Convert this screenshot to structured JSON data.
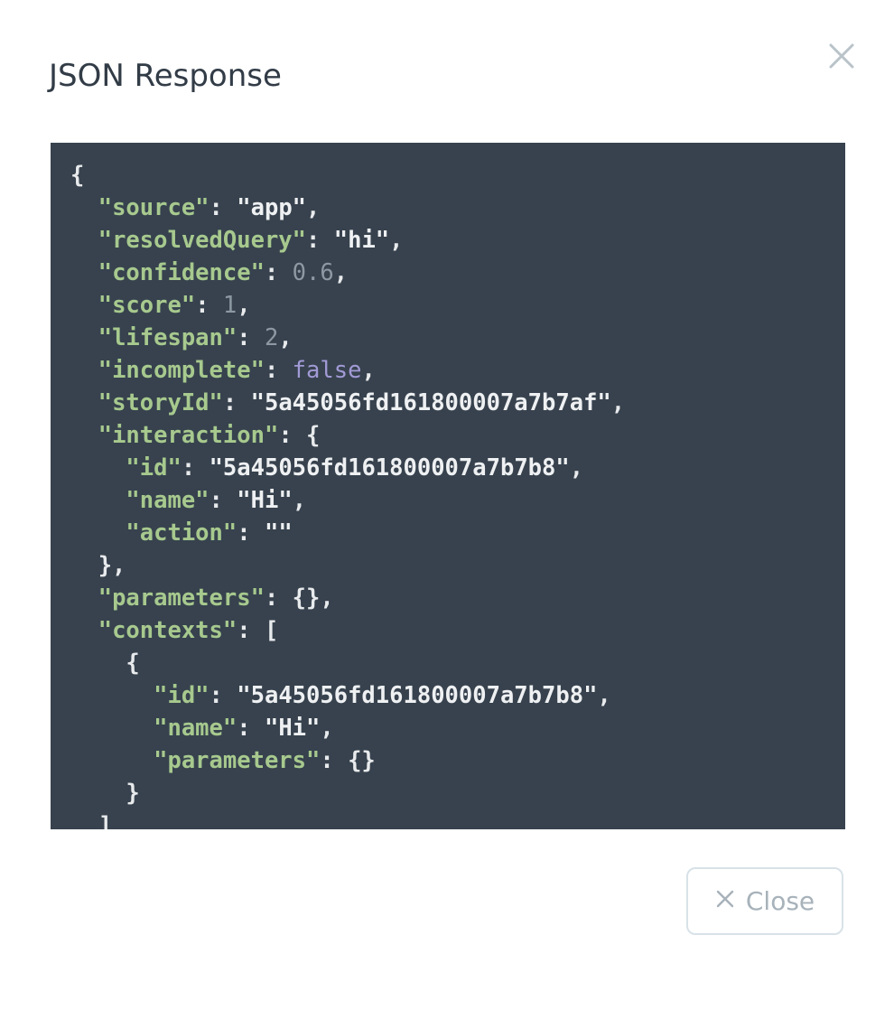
{
  "modal": {
    "title": "JSON Response",
    "close_icon": "close-icon",
    "footer_close_label": "Close",
    "colors": {
      "panel_bg": "#37424e",
      "key": "#a7c98e",
      "string": "#eef0f2",
      "number": "#8d98a3",
      "boolean": "#a29ad6",
      "title": "#323c47",
      "button_border": "#d8e2e8",
      "button_text": "#a7b2ba"
    }
  },
  "code_lines": [
    [
      {
        "t": "p",
        "v": "{"
      }
    ],
    [
      {
        "t": "p",
        "v": "  "
      },
      {
        "t": "k",
        "v": "\"source\""
      },
      {
        "t": "p",
        "v": ": "
      },
      {
        "t": "s",
        "v": "\"app\""
      },
      {
        "t": "p",
        "v": ","
      }
    ],
    [
      {
        "t": "p",
        "v": "  "
      },
      {
        "t": "k",
        "v": "\"resolvedQuery\""
      },
      {
        "t": "p",
        "v": ": "
      },
      {
        "t": "s",
        "v": "\"hi\""
      },
      {
        "t": "p",
        "v": ","
      }
    ],
    [
      {
        "t": "p",
        "v": "  "
      },
      {
        "t": "k",
        "v": "\"confidence\""
      },
      {
        "t": "p",
        "v": ": "
      },
      {
        "t": "n",
        "v": "0.6"
      },
      {
        "t": "p",
        "v": ","
      }
    ],
    [
      {
        "t": "p",
        "v": "  "
      },
      {
        "t": "k",
        "v": "\"score\""
      },
      {
        "t": "p",
        "v": ": "
      },
      {
        "t": "n",
        "v": "1"
      },
      {
        "t": "p",
        "v": ","
      }
    ],
    [
      {
        "t": "p",
        "v": "  "
      },
      {
        "t": "k",
        "v": "\"lifespan\""
      },
      {
        "t": "p",
        "v": ": "
      },
      {
        "t": "n",
        "v": "2"
      },
      {
        "t": "p",
        "v": ","
      }
    ],
    [
      {
        "t": "p",
        "v": "  "
      },
      {
        "t": "k",
        "v": "\"incomplete\""
      },
      {
        "t": "p",
        "v": ": "
      },
      {
        "t": "b",
        "v": "false"
      },
      {
        "t": "p",
        "v": ","
      }
    ],
    [
      {
        "t": "p",
        "v": "  "
      },
      {
        "t": "k",
        "v": "\"storyId\""
      },
      {
        "t": "p",
        "v": ": "
      },
      {
        "t": "s",
        "v": "\"5a45056fd161800007a7b7af\""
      },
      {
        "t": "p",
        "v": ","
      }
    ],
    [
      {
        "t": "p",
        "v": "  "
      },
      {
        "t": "k",
        "v": "\"interaction\""
      },
      {
        "t": "p",
        "v": ": {"
      }
    ],
    [
      {
        "t": "p",
        "v": "    "
      },
      {
        "t": "k",
        "v": "\"id\""
      },
      {
        "t": "p",
        "v": ": "
      },
      {
        "t": "s",
        "v": "\"5a45056fd161800007a7b7b8\""
      },
      {
        "t": "p",
        "v": ","
      }
    ],
    [
      {
        "t": "p",
        "v": "    "
      },
      {
        "t": "k",
        "v": "\"name\""
      },
      {
        "t": "p",
        "v": ": "
      },
      {
        "t": "s",
        "v": "\"Hi\""
      },
      {
        "t": "p",
        "v": ","
      }
    ],
    [
      {
        "t": "p",
        "v": "    "
      },
      {
        "t": "k",
        "v": "\"action\""
      },
      {
        "t": "p",
        "v": ": "
      },
      {
        "t": "s",
        "v": "\"\""
      }
    ],
    [
      {
        "t": "p",
        "v": "  },"
      }
    ],
    [
      {
        "t": "p",
        "v": "  "
      },
      {
        "t": "k",
        "v": "\"parameters\""
      },
      {
        "t": "p",
        "v": ": {},"
      }
    ],
    [
      {
        "t": "p",
        "v": "  "
      },
      {
        "t": "k",
        "v": "\"contexts\""
      },
      {
        "t": "p",
        "v": ": ["
      }
    ],
    [
      {
        "t": "p",
        "v": "    {"
      }
    ],
    [
      {
        "t": "p",
        "v": "      "
      },
      {
        "t": "k",
        "v": "\"id\""
      },
      {
        "t": "p",
        "v": ": "
      },
      {
        "t": "s",
        "v": "\"5a45056fd161800007a7b7b8\""
      },
      {
        "t": "p",
        "v": ","
      }
    ],
    [
      {
        "t": "p",
        "v": "      "
      },
      {
        "t": "k",
        "v": "\"name\""
      },
      {
        "t": "p",
        "v": ": "
      },
      {
        "t": "s",
        "v": "\"Hi\""
      },
      {
        "t": "p",
        "v": ","
      }
    ],
    [
      {
        "t": "p",
        "v": "      "
      },
      {
        "t": "k",
        "v": "\"parameters\""
      },
      {
        "t": "p",
        "v": ": {}"
      }
    ],
    [
      {
        "t": "p",
        "v": "    }"
      }
    ],
    [
      {
        "t": "p",
        "v": "  ]"
      }
    ]
  ]
}
